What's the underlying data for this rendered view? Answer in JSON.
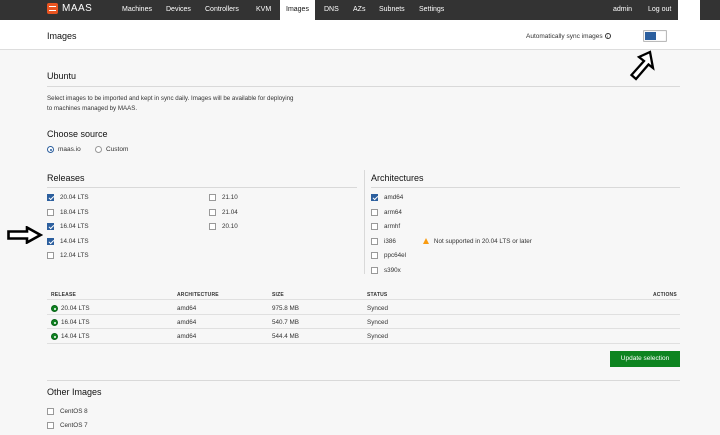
{
  "nav": {
    "brand": "MAAS",
    "items": [
      "Machines",
      "Devices",
      "Controllers",
      "KVM",
      "Images",
      "DNS",
      "AZs",
      "Subnets",
      "Settings"
    ],
    "active": "Images",
    "user": "admin",
    "logout": "Log out"
  },
  "header": {
    "title": "Images",
    "sync_label": "Automatically sync images",
    "sync_enabled": true
  },
  "ubuntu": {
    "title": "Ubuntu",
    "description_line1": "Select images to be imported and kept in sync daily. Images will be available for deploying",
    "description_line2": "to machines managed by MAAS."
  },
  "source": {
    "title": "Choose source",
    "options": [
      {
        "label": "maas.io",
        "selected": true
      },
      {
        "label": "Custom",
        "selected": false
      }
    ]
  },
  "releases": {
    "title": "Releases",
    "col1": [
      {
        "label": "20.04 LTS",
        "checked": true
      },
      {
        "label": "18.04 LTS",
        "checked": false
      },
      {
        "label": "16.04 LTS",
        "checked": true
      },
      {
        "label": "14.04 LTS",
        "checked": true
      },
      {
        "label": "12.04 LTS",
        "checked": false
      }
    ],
    "col2": [
      {
        "label": "21.10",
        "checked": false
      },
      {
        "label": "21.04",
        "checked": false
      },
      {
        "label": "20.10",
        "checked": false
      }
    ]
  },
  "architectures": {
    "title": "Architectures",
    "items": [
      {
        "label": "amd64",
        "checked": true,
        "note": ""
      },
      {
        "label": "arm64",
        "checked": false,
        "note": ""
      },
      {
        "label": "armhf",
        "checked": false,
        "note": ""
      },
      {
        "label": "i386",
        "checked": false,
        "note": "Not supported in 20.04 LTS or later"
      },
      {
        "label": "ppc64el",
        "checked": false,
        "note": ""
      },
      {
        "label": "s390x",
        "checked": false,
        "note": ""
      }
    ]
  },
  "table": {
    "headers": {
      "release": "RELEASE",
      "architecture": "ARCHITECTURE",
      "size": "SIZE",
      "status": "STATUS",
      "actions": "ACTIONS"
    },
    "rows": [
      {
        "release": "20.04 LTS",
        "architecture": "amd64",
        "size": "975.8 MB",
        "status": "Synced"
      },
      {
        "release": "16.04 LTS",
        "architecture": "amd64",
        "size": "540.7 MB",
        "status": "Synced"
      },
      {
        "release": "14.04 LTS",
        "architecture": "amd64",
        "size": "544.4 MB",
        "status": "Synced"
      }
    ]
  },
  "update_button": "Update selection",
  "other_images": {
    "title": "Other Images",
    "items": [
      {
        "label": "CentOS 8",
        "checked": false
      },
      {
        "label": "CentOS 7",
        "checked": false
      }
    ]
  },
  "colors": {
    "nav_bg": "#333333",
    "accent_blue": "#2c5f9e",
    "success_green": "#0e8420",
    "warning_orange": "#f99b11",
    "brand_orange": "#e95420"
  }
}
